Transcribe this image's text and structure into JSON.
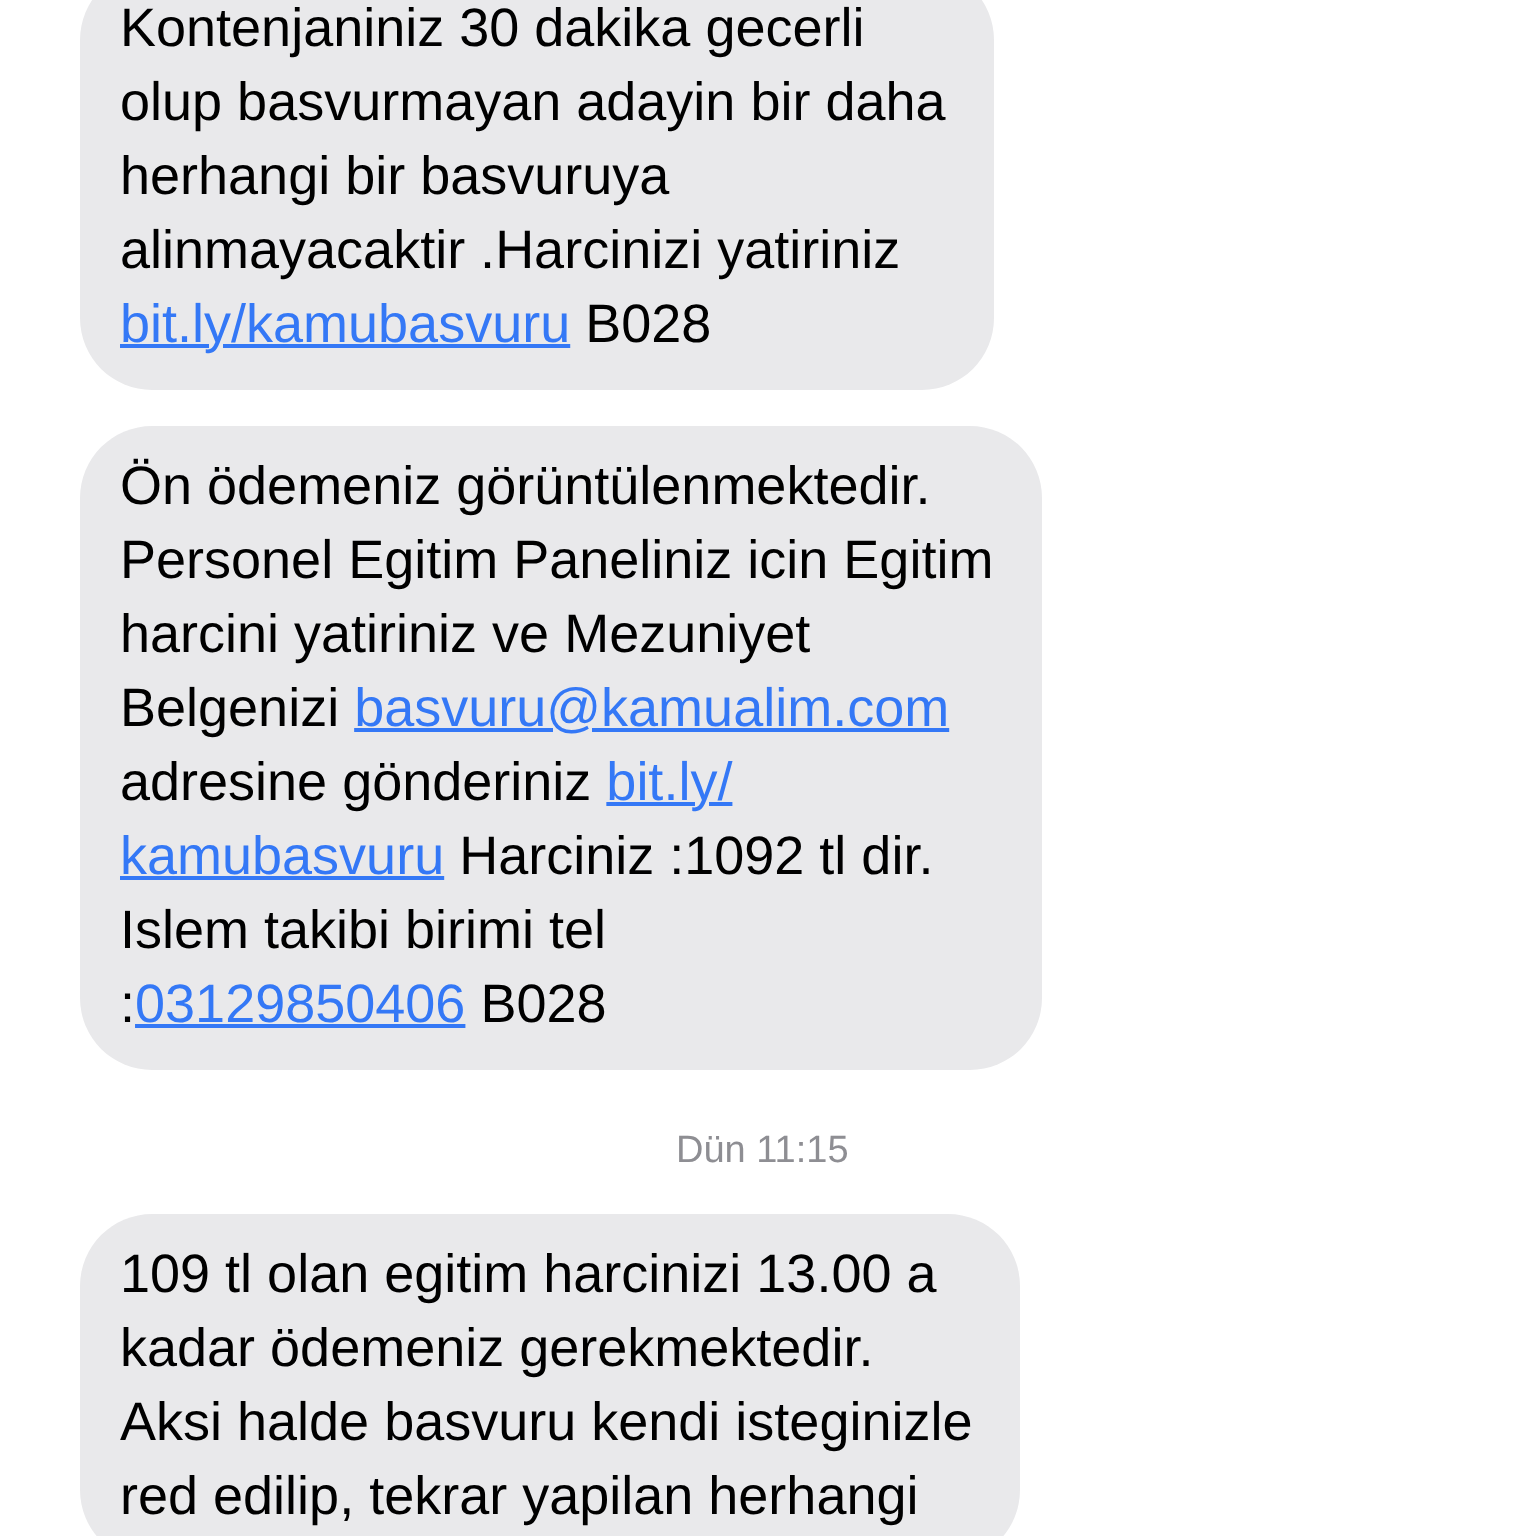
{
  "items": [
    {
      "kind": "message",
      "lines": [
        [
          {
            "kind": "text",
            "text": "Kontenjaniniz 30 dakika gecerli"
          }
        ],
        [
          {
            "kind": "text",
            "text": "olup basvurmayan adayin bir daha"
          }
        ],
        [
          {
            "kind": "text",
            "text": "herhangi bir basvuruya"
          }
        ],
        [
          {
            "kind": "text",
            "text": "alinmayacaktir .Harcinizi yatiriniz"
          }
        ],
        [
          {
            "kind": "link",
            "text": "bit.ly/kamubasvuru"
          },
          {
            "kind": "text",
            "text": " B028"
          }
        ]
      ]
    },
    {
      "kind": "message",
      "lines": [
        [
          {
            "kind": "text",
            "text": "Ön ödemeniz görüntülenmektedir."
          }
        ],
        [
          {
            "kind": "text",
            "text": "Personel Egitim Paneliniz icin Egitim"
          }
        ],
        [
          {
            "kind": "text",
            "text": "harcini yatiriniz ve Mezuniyet"
          }
        ],
        [
          {
            "kind": "text",
            "text": "Belgenizi "
          },
          {
            "kind": "link",
            "text": "basvuru@kamualim.com"
          }
        ],
        [
          {
            "kind": "text",
            "text": "adresine gönderiniz "
          },
          {
            "kind": "link",
            "text": "bit.ly/"
          }
        ],
        [
          {
            "kind": "link",
            "text": "kamubasvuru"
          },
          {
            "kind": "text",
            "text": " Harciniz :1092 tl dir."
          }
        ],
        [
          {
            "kind": "text",
            "text": "Islem takibi birimi tel"
          }
        ],
        [
          {
            "kind": "text",
            "text": ":"
          },
          {
            "kind": "link",
            "text": "03129850406"
          },
          {
            "kind": "text",
            "text": " B028"
          }
        ]
      ]
    },
    {
      "kind": "timestamp",
      "text": "Dün 11:15"
    },
    {
      "kind": "message",
      "lines": [
        [
          {
            "kind": "text",
            "text": "109 tl olan egitim harcinizi 13.00 a"
          }
        ],
        [
          {
            "kind": "text",
            "text": "kadar ödemeniz gerekmektedir."
          }
        ],
        [
          {
            "kind": "text",
            "text": "Aksi halde basvuru kendi isteginizle"
          }
        ],
        [
          {
            "kind": "text",
            "text": "red edilip, tekrar yapilan herhangi"
          }
        ]
      ]
    }
  ]
}
